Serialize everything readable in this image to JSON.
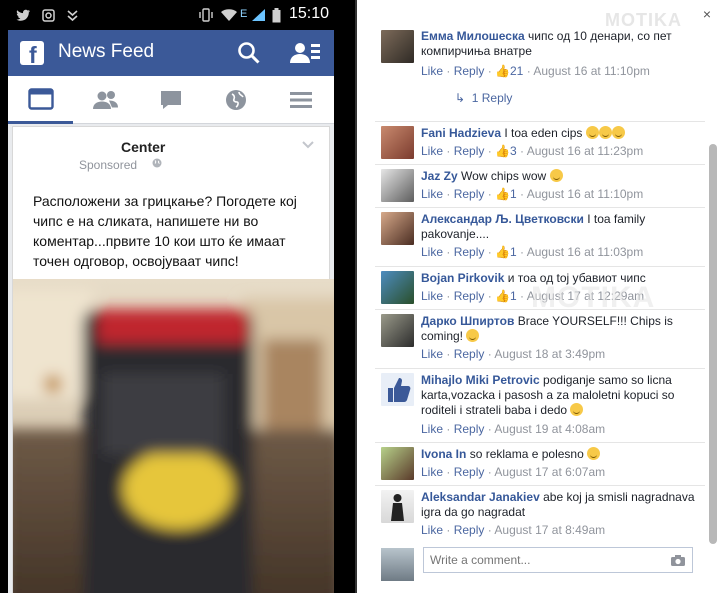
{
  "status_bar": {
    "time": "15:10",
    "network": "E",
    "icons": [
      "twitter-icon",
      "instagram-icon",
      "download-icon",
      "vibrate-icon",
      "wifi-icon",
      "signal-icon",
      "battery-icon"
    ]
  },
  "fb": {
    "brand_color": "#3b5998",
    "header_title": "News Feed",
    "tabs": [
      "news-feed-tab",
      "friends-tab",
      "messages-tab",
      "notifications-tab",
      "menu-tab"
    ],
    "post": {
      "page_name": "Center",
      "sponsored": "Sponsored",
      "text": "Расположени за грицкање? Погодете кој чипс е на сликата, напишете ни во коментар...првите 10 кои што ќе имаат точен одговор, освојуваат чипс!"
    }
  },
  "comments_panel": {
    "watermark": "MOTIKA",
    "comments": [
      {
        "author": "Емма Милошеска",
        "text": "чипс од 10 денари, со пет компирчиња внатре",
        "like": "Like",
        "reply": "Reply",
        "likes": "21",
        "time": "August 16 at 11:10pm",
        "replies": "1 Reply"
      },
      {
        "author": "Fani Hadzieva",
        "text": "I toa eden cips",
        "like": "Like",
        "reply": "Reply",
        "likes": "3",
        "time": "August 16 at 11:23pm"
      },
      {
        "author": "Jaz Zy",
        "text": "Wow chips wow",
        "like": "Like",
        "reply": "Reply",
        "likes": "1",
        "time": "August 16 at 11:10pm"
      },
      {
        "author": "Александар Љ. Цветковски",
        "text": "I toa family pakovanje....",
        "like": "Like",
        "reply": "Reply",
        "likes": "1",
        "time": "August 16 at 11:03pm"
      },
      {
        "author": "Bojan Pirkovik",
        "text": "и тоа од toj убавиот чипс",
        "like": "Like",
        "reply": "Reply",
        "likes": "1",
        "time": "August 17 at 12:29am"
      },
      {
        "author": "Дарко Шпиртов",
        "text": "Brace YOURSELF!!! Chips is coming!",
        "like": "Like",
        "reply": "Reply",
        "time": "August 18 at 3:49pm"
      },
      {
        "author": "Mihajlo Miki Petrovic",
        "text": "podiganje samo so licna karta,vozacka i pasosh a za maloletni kopuci so roditeli i strateli baba i dedo",
        "like": "Like",
        "reply": "Reply",
        "time": "August 19 at 4:08am"
      },
      {
        "author": "Ivona In",
        "text": "so reklama e polesno",
        "like": "Like",
        "reply": "Reply",
        "time": "August 17 at 6:07am"
      },
      {
        "author": "Aleksandar Janakiev",
        "text": "abe koj ja smisli nagradnava igra da go nagradat",
        "like": "Like",
        "reply": "Reply",
        "time": "August 17 at 8:49am"
      }
    ],
    "composer_placeholder": "Write a comment...",
    "close": "×"
  }
}
